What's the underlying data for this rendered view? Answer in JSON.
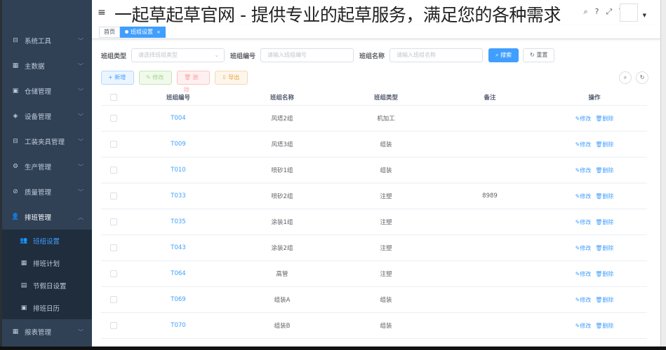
{
  "overlay_title": "一起草起草官网 - 提供专业的起草服务，满足您的各种需求",
  "sidebar": {
    "items": [
      {
        "label": "系统工具",
        "icon": "toolbox-icon"
      },
      {
        "label": "主数据",
        "icon": "grid-icon"
      },
      {
        "label": "仓储管理",
        "icon": "warehouse-icon"
      },
      {
        "label": "设备管理",
        "icon": "layers-icon"
      },
      {
        "label": "工装夹具管理",
        "icon": "toolbox-icon"
      },
      {
        "label": "生产管理",
        "icon": "gear-icon"
      },
      {
        "label": "质量管理",
        "icon": "quality-icon"
      }
    ],
    "open_item": {
      "label": "排班管理",
      "icon": "users-icon"
    },
    "subitems": [
      {
        "label": "班组设置",
        "icon": "users-icon"
      },
      {
        "label": "排班计划",
        "icon": "calendar-icon"
      },
      {
        "label": "节假日设置",
        "icon": "holiday-icon"
      },
      {
        "label": "排班日历",
        "icon": "calendar-icon"
      }
    ],
    "last_item": {
      "label": "报表管理",
      "icon": "report-icon"
    }
  },
  "tags": {
    "home": "首页",
    "active": "班组设置",
    "close": "×"
  },
  "form": {
    "type_label": "班组类型",
    "type_placeholder": "请选择班组类型",
    "code_label": "班组编号",
    "code_placeholder": "请输入班组编号",
    "name_label": "班组名称",
    "name_placeholder": "请输入班组名称",
    "search_btn": "搜索",
    "reset_btn": "重置"
  },
  "toolbar": {
    "add": "新增",
    "edit": "修改",
    "delete": "删除",
    "export": "导出"
  },
  "table": {
    "headers": {
      "code": "班组编号",
      "name": "班组名称",
      "type": "班组类型",
      "note": "备注",
      "op": "操作"
    },
    "op_edit": "修改",
    "op_delete": "删除",
    "rows": [
      {
        "code": "T004",
        "name": "风塔2组",
        "type": "机加工",
        "note": ""
      },
      {
        "code": "T009",
        "name": "风塔3组",
        "type": "组装",
        "note": ""
      },
      {
        "code": "T010",
        "name": "喷砂1组",
        "type": "组装",
        "note": ""
      },
      {
        "code": "T033",
        "name": "喷砂2组",
        "type": "注塑",
        "note": "8989"
      },
      {
        "code": "T035",
        "name": "涂装1组",
        "type": "注塑",
        "note": ""
      },
      {
        "code": "T043",
        "name": "涂装2组",
        "type": "注塑",
        "note": ""
      },
      {
        "code": "T064",
        "name": "高管",
        "type": "注塑",
        "note": ""
      },
      {
        "code": "T069",
        "name": "组装A",
        "type": "组装",
        "note": ""
      },
      {
        "code": "T070",
        "name": "组装B",
        "type": "组装",
        "note": ""
      }
    ]
  },
  "colors": {
    "sidebar_bg": "#304156",
    "submenu_bg": "#1f2d3d",
    "primary": "#409eff"
  }
}
